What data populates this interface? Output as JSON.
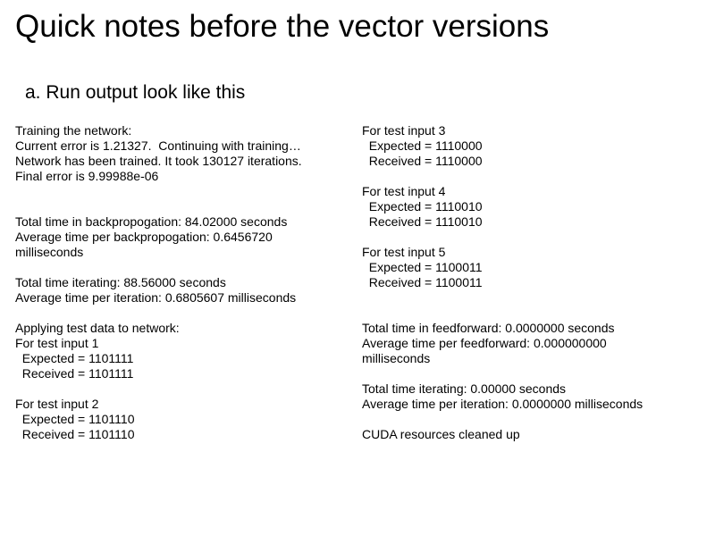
{
  "title": "Quick notes before the vector versions",
  "subhead": "a. Run output look like this",
  "col1": "Training the network:\nCurrent error is 1.21327.  Continuing with training…\nNetwork has been trained. It took 130127 iterations.\nFinal error is 9.99988e-06\n\n\nTotal time in backpropogation: 84.02000 seconds\nAverage time per backpropogation: 0.6456720\nmilliseconds\n\nTotal time iterating: 88.56000 seconds\nAverage time per iteration: 0.6805607 milliseconds\n\nApplying test data to network:\nFor test input 1\n  Expected = 1101111\n  Received = 1101111\n\nFor test input 2\n  Expected = 1101110\n  Received = 1101110",
  "col2": "For test input 3\n  Expected = 1110000\n  Received = 1110000\n\nFor test input 4\n  Expected = 1110010\n  Received = 1110010\n\nFor test input 5\n  Expected = 1100011\n  Received = 1100011\n\n\nTotal time in feedforward: 0.0000000 seconds\nAverage time per feedforward: 0.000000000\nmilliseconds\n\nTotal time iterating: 0.00000 seconds\nAverage time per iteration: 0.0000000 milliseconds\n\nCUDA resources cleaned up"
}
